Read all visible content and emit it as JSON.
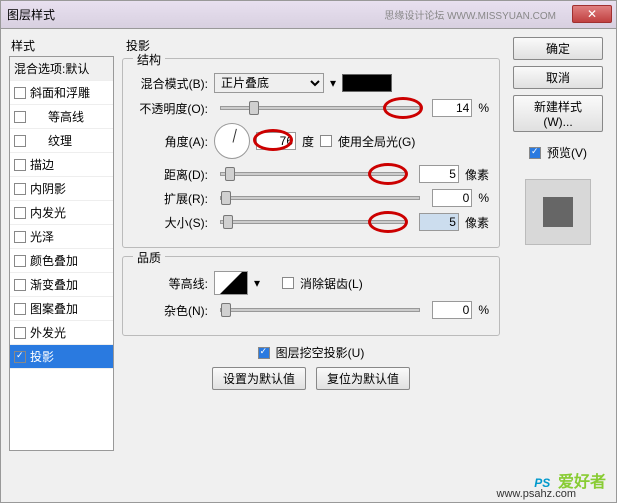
{
  "title": "图层样式",
  "watermark_small": "思缘设计论坛  WWW.MISSYUAN.COM",
  "left_header": "样式",
  "styles": {
    "blend_defaults": "混合选项:默认",
    "items": [
      {
        "label": "斜面和浮雕",
        "sub": false
      },
      {
        "label": "等高线",
        "sub": true
      },
      {
        "label": "纹理",
        "sub": true
      },
      {
        "label": "描边",
        "sub": false
      },
      {
        "label": "内阴影",
        "sub": false
      },
      {
        "label": "内发光",
        "sub": false
      },
      {
        "label": "光泽",
        "sub": false
      },
      {
        "label": "颜色叠加",
        "sub": false
      },
      {
        "label": "渐变叠加",
        "sub": false
      },
      {
        "label": "图案叠加",
        "sub": false
      },
      {
        "label": "外发光",
        "sub": false
      },
      {
        "label": "投影",
        "sub": false,
        "sel": true
      }
    ]
  },
  "panel": {
    "title": "投影",
    "group_struct": "结构",
    "blend_mode_label": "混合模式(B):",
    "blend_mode_value": "正片叠底",
    "opacity_label": "不透明度(O):",
    "opacity_value": "14",
    "pct": "%",
    "angle_label": "角度(A):",
    "angle_value": "76",
    "deg": "度",
    "global_light": "使用全局光(G)",
    "distance_label": "距离(D):",
    "distance_value": "5",
    "px": "像素",
    "spread_label": "扩展(R):",
    "spread_value": "0",
    "size_label": "大小(S):",
    "size_value": "5",
    "group_quality": "品质",
    "contour_label": "等高线:",
    "antialias": "消除锯齿(L)",
    "noise_label": "杂色(N):",
    "noise_value": "0",
    "knockout": "图层挖空投影(U)",
    "btn_default": "设置为默认值",
    "btn_reset": "复位为默认值"
  },
  "right": {
    "ok": "确定",
    "cancel": "取消",
    "newstyle": "新建样式(W)...",
    "preview": "预览(V)"
  },
  "wm": {
    "ps": "PS",
    "tx": "爱好者",
    "url": "www.psahz.com"
  }
}
